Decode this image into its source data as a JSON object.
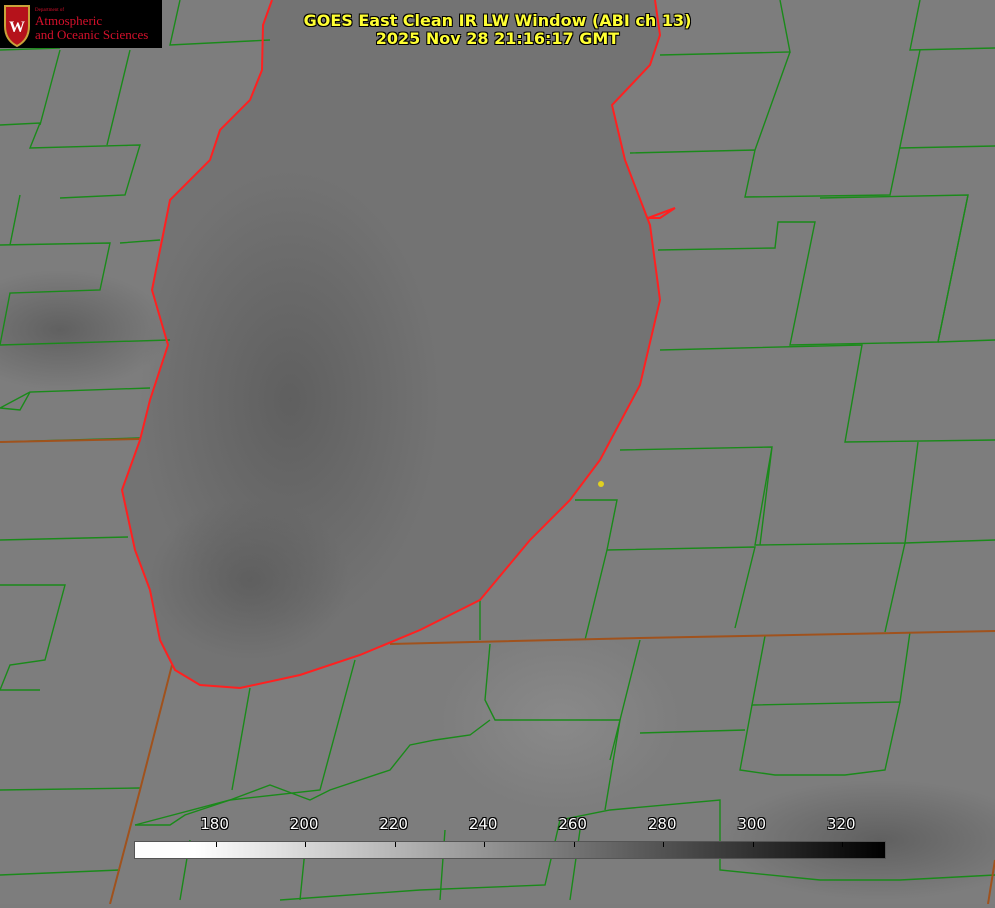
{
  "title": {
    "line1": "GOES East Clean IR LW Window (ABI ch 13)",
    "line2": "2025 Nov 28 21:16:17 GMT"
  },
  "logo": {
    "dept": "Department of",
    "line1": "Atmospheric",
    "line2": "and Oceanic Sciences",
    "crest_letter": "W"
  },
  "colorbar": {
    "ticks": [
      "180",
      "200",
      "220",
      "240",
      "260",
      "280",
      "300",
      "320"
    ],
    "tick_values": [
      180,
      200,
      220,
      240,
      260,
      280,
      300,
      320
    ],
    "range": [
      162,
      330
    ]
  },
  "colors": {
    "county_lines": "#1a8a1a",
    "state_lines": "#a0521d",
    "lake_coast": "#ff2020",
    "marker": "#e0d020",
    "title": "#ffff33"
  }
}
